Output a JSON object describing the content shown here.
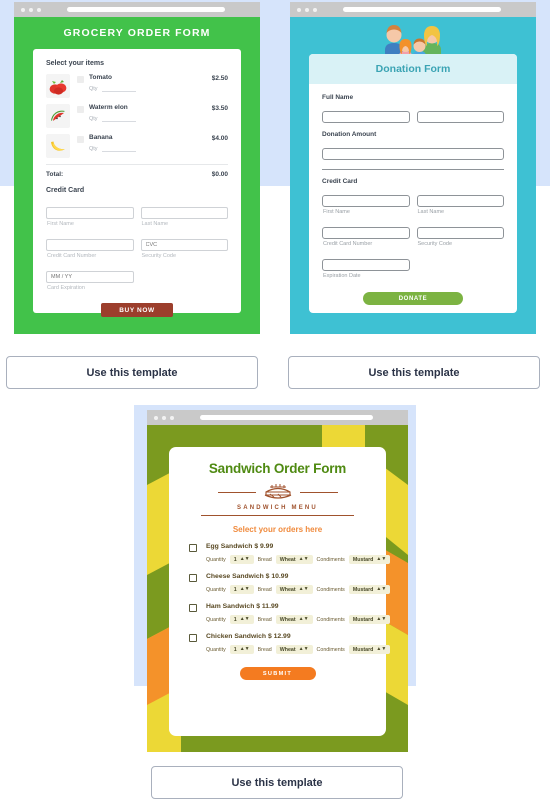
{
  "page": {
    "background": "#ffffff",
    "accent_band": "#d6e4fb"
  },
  "templates": [
    {
      "id": "grocery",
      "use_button_label": "Use this template",
      "theme_color": "#42c24a",
      "title": "GROCERY ORDER FORM",
      "section_label": "Select your items",
      "items": [
        {
          "name": "Tomato",
          "price": "$2.50",
          "qty_label": "Qty",
          "icon": "tomato-icon"
        },
        {
          "name": "Waterm elon",
          "price": "$3.50",
          "qty_label": "Qty",
          "icon": "watermelon-icon"
        },
        {
          "name": "Banana",
          "price": "$4.00",
          "qty_label": "Qty",
          "icon": "banana-icon"
        }
      ],
      "total_label": "Total:",
      "total_value": "$0.00",
      "credit_card_label": "Credit Card",
      "fields": {
        "first_name_caption": "First Name",
        "last_name_caption": "Last Name",
        "card_number_caption": "Credit Card Number",
        "security_code_caption": "Security Code",
        "cvc_placeholder": "CVC",
        "expiration_caption": "Card Expiration",
        "expiration_placeholder": "MM / YY"
      },
      "submit_label": "BUY NOW",
      "submit_color": "#9c3e2c"
    },
    {
      "id": "donation",
      "use_button_label": "Use this template",
      "theme_color": "#3ec1d3",
      "title": "Donation Form",
      "header_bg": "#d9f2f6",
      "illustration": "family-illustration",
      "full_name_label": "Full Name",
      "donation_amount_label": "Donation Amount",
      "credit_card_label": "Credit Card",
      "fields": {
        "first_name_caption": "First Name",
        "last_name_caption": "Last Name",
        "card_number_caption": "Credit Card Number",
        "security_code_caption": "Security Code",
        "expiration_caption": "Expiration Date"
      },
      "submit_label": "DONATE",
      "submit_color": "#7cb342"
    },
    {
      "id": "sandwich",
      "use_button_label": "Use this template",
      "theme_color": "#7b9a1f",
      "title": "Sandwich Order Form",
      "menu_label": "SANDWICH MENU",
      "subtitle": "Select your orders here",
      "option_labels": {
        "quantity": "Quantity",
        "bread": "Bread",
        "condiments": "Condiments"
      },
      "items": [
        {
          "name": "Egg Sandwich $ 9.99",
          "quantity": "1",
          "bread": "Wheat",
          "condiments": "Mustard"
        },
        {
          "name": "Cheese Sandwich $ 10.99",
          "quantity": "1",
          "bread": "Wheat",
          "condiments": "Mustard"
        },
        {
          "name": "Ham Sandwich $ 11.99",
          "quantity": "1",
          "bread": "Wheat",
          "condiments": "Mustard"
        },
        {
          "name": "Chicken Sandwich $ 12.99",
          "quantity": "1",
          "bread": "Wheat",
          "condiments": "Mustard"
        }
      ],
      "submit_label": "SUBMIT",
      "submit_color": "#f47b20"
    }
  ]
}
